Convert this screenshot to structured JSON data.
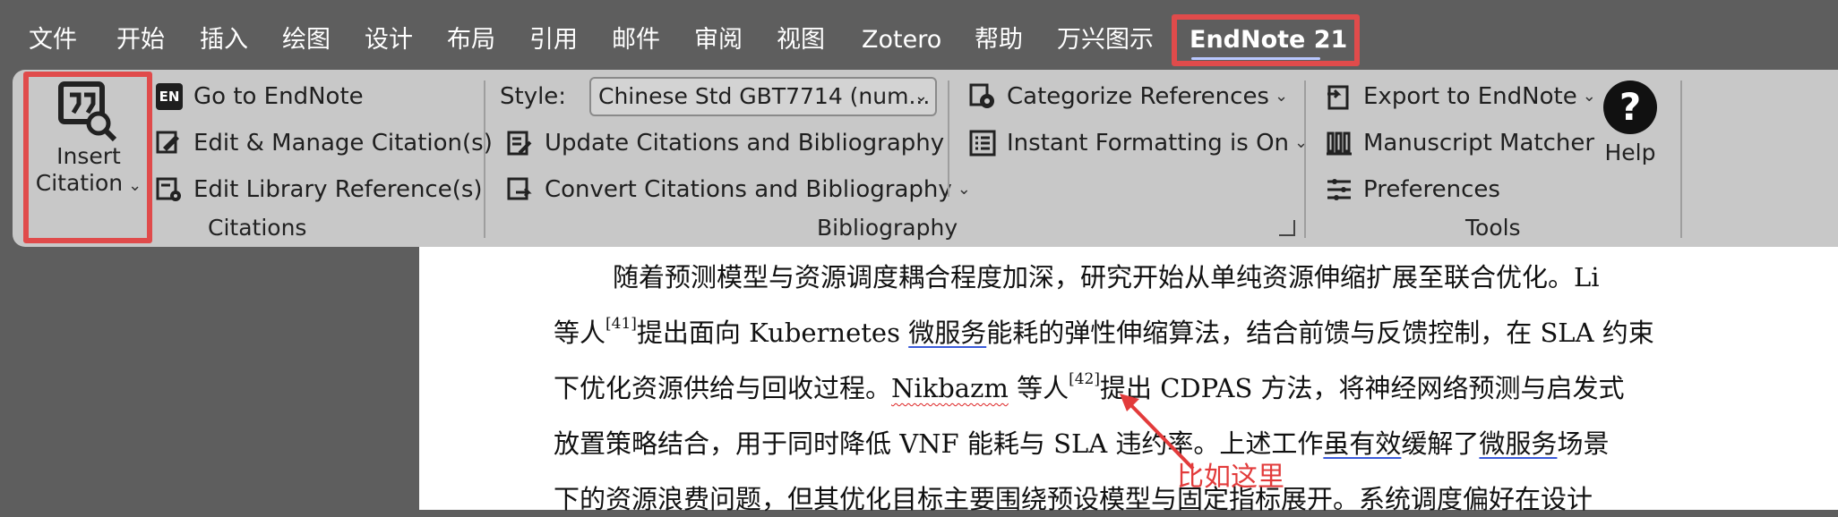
{
  "menu": {
    "tabs": [
      "文件",
      "开始",
      "插入",
      "绘图",
      "设计",
      "布局",
      "引用",
      "邮件",
      "审阅",
      "视图",
      "Zotero",
      "帮助",
      "万兴图示",
      "EndNote 21"
    ]
  },
  "ribbon": {
    "citations": {
      "insert_citation_line1": "Insert",
      "insert_citation_line2": "Citation",
      "go_to_endnote": "Go to EndNote",
      "edit_manage": "Edit & Manage Citation(s)",
      "edit_library": "Edit Library Reference(s)",
      "group_label": "Citations"
    },
    "bibliography": {
      "style_label": "Style:",
      "style_value": "Chinese Std GBT7714 (num...",
      "update": "Update Citations and Bibliography",
      "convert": "Convert Citations and Bibliography",
      "categorize": "Categorize References",
      "instant_formatting": "Instant Formatting is On",
      "group_label": "Bibliography"
    },
    "tools": {
      "export": "Export to EndNote",
      "manuscript": "Manuscript Matcher",
      "preferences": "Preferences",
      "help": "Help",
      "group_label": "Tools"
    }
  },
  "document": {
    "l1": "随着预测模型与资源调度耦合程度加深，研究开始从单纯资源伸缩扩展至联合优化。Li",
    "l2a": "等人",
    "l2cite": "[41]",
    "l2b": "提出面向 Kubernetes ",
    "l2u": "微服务",
    "l2c": "能耗的弹性伸缩算法，结合前馈与反馈控制，在 SLA 约束",
    "l3a": "下优化资源供给与回收过程。",
    "l3s": "Nikbazm",
    "l3b": " 等人",
    "l3cite": "[42]",
    "l3c": "提出 CDPAS 方法，将神经网络预测与启发式",
    "l4a": "放置策略结合，用于同时降低 VNF 能耗与 SLA 违约率。上述工作",
    "l4u1": "虽有效",
    "l4b": "缓解了",
    "l4u2": "微服务",
    "l4c": "场景",
    "l5": "下的资源浪费问题，但其优化目标主要围绕预设模型与固定指标展开。系统调度偏好在设计"
  },
  "annotation": "比如这里",
  "colors": {
    "highlight": "#e04b4b",
    "annotation": "#e23b3b",
    "ribbon": "#c8c8c8",
    "background": "#5e5e5e"
  }
}
